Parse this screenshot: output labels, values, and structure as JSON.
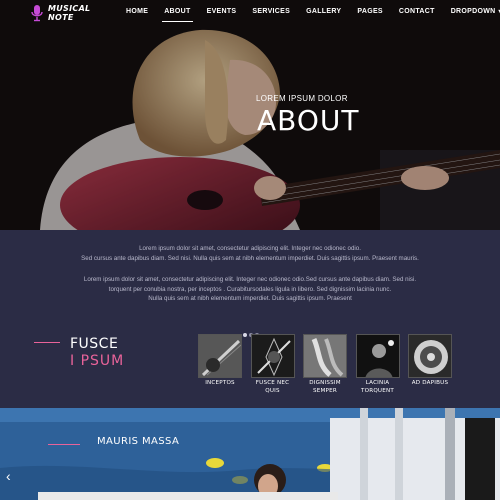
{
  "brand": {
    "line1": "MUSICAL",
    "line2": "NOTE",
    "icon": "microphone-icon",
    "accent": "#c64bd6"
  },
  "nav": {
    "items": [
      {
        "label": "HOME"
      },
      {
        "label": "ABOUT"
      },
      {
        "label": "EVENTS"
      },
      {
        "label": "SERVICES"
      },
      {
        "label": "GALLERY"
      },
      {
        "label": "PAGES"
      },
      {
        "label": "CONTACT"
      },
      {
        "label": "DROPDOWN"
      }
    ],
    "active": "ABOUT",
    "dropdown_caret": "▾"
  },
  "hero": {
    "subtitle": "LOREM IPSUM DOLOR",
    "title": "ABOUT"
  },
  "intro": {
    "paragraph1": [
      "Lorem ipsum dolor sit amet, consectetur adipiscing elit. Integer nec odionec odio.",
      "Sed cursus ante dapibus diam. Sed nisi. Nulla quis sem at nibh elementum imperdiet. Duis sagittis ipsum. Praesent mauris."
    ],
    "paragraph2": [
      "Lorem ipsum dolor sit amet, consectetur adipiscing elit. Integer nec odionec odio.Sed cursus ante dapibus diam. Sed nisi.",
      "torquent per conubia nostra, per inceptos . Curabitursodales ligula in libero. Sed dignissim lacinia nunc.",
      "Nulla quis sem at nibh elementum imperdiet. Duis sagittis ipsum. Praesent"
    ]
  },
  "feature": {
    "line1": "FUSCE",
    "line2": "I PSUM",
    "accent": "#e9639a"
  },
  "gallery": [
    {
      "label": "INCEPTOS"
    },
    {
      "label": "FUSCE NEC QUIS"
    },
    {
      "label": "DIGNISSIM SEMPER"
    },
    {
      "label": "LACINIA TORQUENT"
    },
    {
      "label": "AD DAPIBUS"
    }
  ],
  "bottom": {
    "heading": "MAURIS MASSA",
    "prev_arrow": "‹"
  }
}
